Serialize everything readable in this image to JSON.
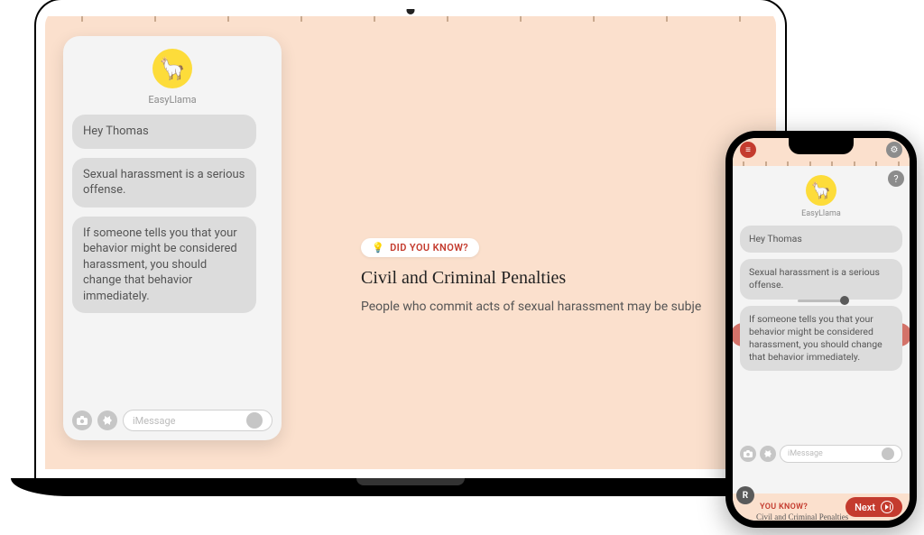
{
  "chat": {
    "sender_name": "EasyLlama",
    "avatar_emoji": "🦙",
    "messages": [
      "Hey Thomas",
      "Sexual harassment is a serious offense.",
      "If someone tells you that your behavior might be considered harassment, you should change that behavior immediately."
    ],
    "input_placeholder": "iMessage"
  },
  "lesson": {
    "pill_icon": "💡",
    "pill_label": "DID YOU KNOW?",
    "title": "Civil and Criminal Penalties",
    "body_desktop": "People who commit acts of sexual harassment may be subje",
    "body_mobile_title": "Civil and Criminal Penalties"
  },
  "phone": {
    "menu_icon": "≡",
    "settings_icon": "⚙",
    "help_icon": "?",
    "restart_icon": "R",
    "footer_pill": "YOU KNOW?",
    "next_label": "Next"
  }
}
